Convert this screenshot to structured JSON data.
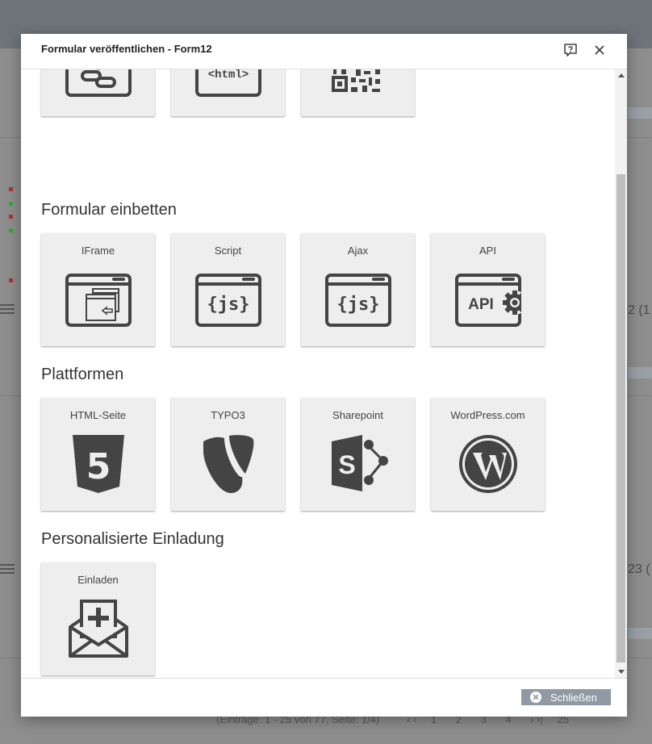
{
  "dialog": {
    "title": "Formular veröffentlichen - Form12",
    "close_button_label": "Schließen"
  },
  "sections": [
    {
      "heading": "",
      "tiles": [
        {
          "label": "",
          "icon": "link-icon"
        },
        {
          "label": "",
          "icon": "html-icon"
        },
        {
          "label": "",
          "icon": "qr-code-icon"
        }
      ]
    },
    {
      "heading": "Formular einbetten",
      "tiles": [
        {
          "label": "IFrame",
          "icon": "iframe-icon"
        },
        {
          "label": "Script",
          "icon": "js-script-icon"
        },
        {
          "label": "Ajax",
          "icon": "js-ajax-icon"
        },
        {
          "label": "API",
          "icon": "api-icon"
        }
      ]
    },
    {
      "heading": "Plattformen",
      "tiles": [
        {
          "label": "HTML-Seite",
          "icon": "html5-icon"
        },
        {
          "label": "TYPO3",
          "icon": "typo3-icon"
        },
        {
          "label": "Sharepoint",
          "icon": "sharepoint-icon"
        },
        {
          "label": "WordPress.com",
          "icon": "wordpress-icon"
        }
      ]
    },
    {
      "heading": "Personalisierte Einladung",
      "tiles": [
        {
          "label": "Einladen",
          "icon": "invite-envelope-icon"
        }
      ]
    }
  ],
  "icon_texts": {
    "html": "<html>",
    "js": "{js}",
    "api": "API",
    "html5": "5",
    "sharepoint": "S"
  },
  "background": {
    "row_counts": [
      "2 (1",
      "23 ("
    ],
    "pager_text": "(Einträge: 1 - 25 von 77, Seite: 1/4)",
    "pages": [
      "1",
      "2",
      "3",
      "4"
    ],
    "page_size": "25"
  },
  "colors": {
    "icon": "#444444",
    "tile_bg": "#eeeeee",
    "close_button_bg": "#8f9aa5"
  }
}
